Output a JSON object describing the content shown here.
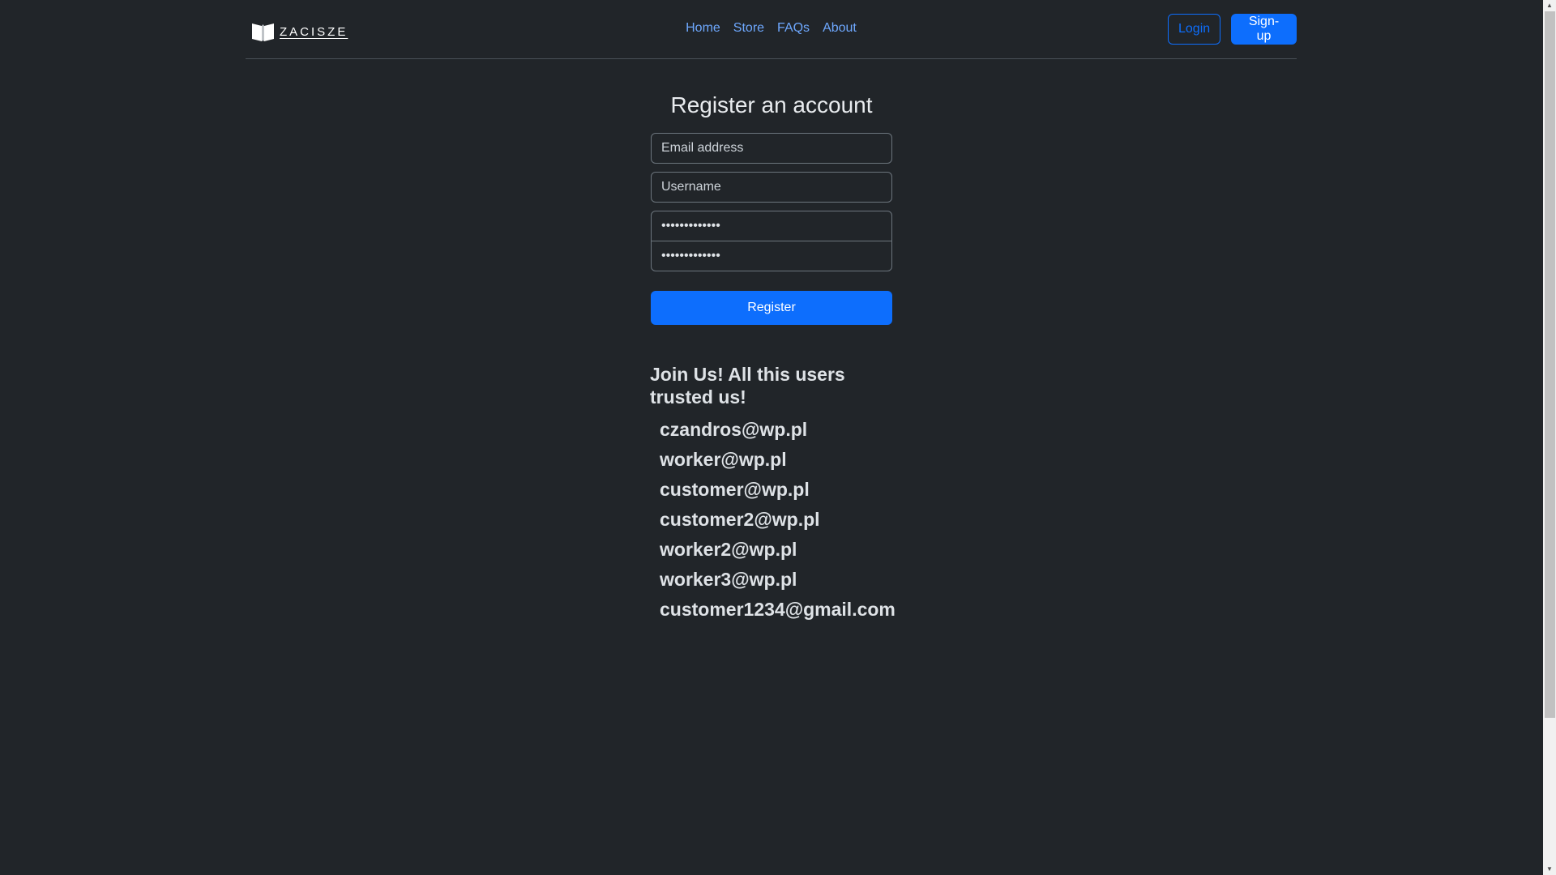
{
  "header": {
    "logo_text": "ZACISZE",
    "nav": [
      {
        "label": "Home"
      },
      {
        "label": "Store"
      },
      {
        "label": "FAQs"
      },
      {
        "label": "About"
      }
    ],
    "login_label": "Login",
    "signup_label": "Sign-up"
  },
  "form": {
    "title": "Register an account",
    "email_placeholder": "Email address",
    "username_placeholder": "Username",
    "password_value": "•••••••••••••",
    "confirm_password_value": "•••••••••••••",
    "register_label": "Register"
  },
  "users": {
    "heading": "Join Us! All this users trusted us!",
    "items": [
      "czandros@wp.pl",
      "worker@wp.pl",
      "customer@wp.pl",
      "customer2@wp.pl",
      "worker2@wp.pl",
      "worker3@wp.pl",
      "customer1234@gmail.com"
    ]
  },
  "colors": {
    "background": "#212529",
    "primary": "#0d6efd",
    "link": "#6ea8fe"
  },
  "icons": {
    "logo": "open-book-icon"
  }
}
